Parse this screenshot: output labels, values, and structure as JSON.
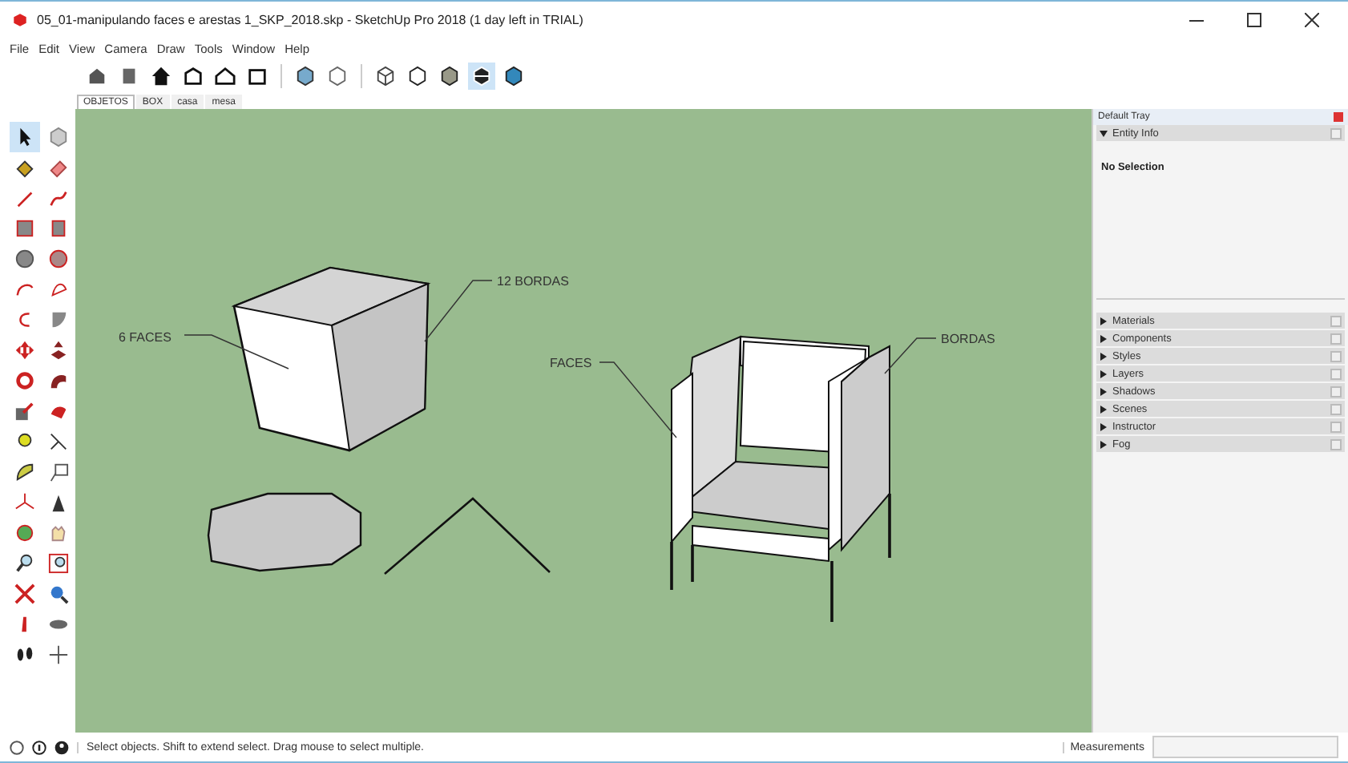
{
  "window": {
    "title": "05_01-manipulando faces e arestas 1_SKP_2018.skp - SketchUp Pro 2018 (1 day left in TRIAL)"
  },
  "menu": [
    "File",
    "Edit",
    "View",
    "Camera",
    "Draw",
    "Tools",
    "Window",
    "Help"
  ],
  "scene_tabs": [
    {
      "label": "OBJETOS",
      "selected": true
    },
    {
      "label": "BOX",
      "selected": false
    },
    {
      "label": "casa",
      "selected": false
    },
    {
      "label": "mesa",
      "selected": false
    }
  ],
  "canvas": {
    "labels": [
      "6 FACES",
      "12 BORDAS",
      "FACES",
      "BORDAS"
    ]
  },
  "tray": {
    "title": "Default Tray",
    "panels": [
      {
        "label": "Entity Info",
        "expanded": true,
        "content": "No Selection"
      },
      {
        "label": "Materials",
        "expanded": false
      },
      {
        "label": "Components",
        "expanded": false
      },
      {
        "label": "Styles",
        "expanded": false
      },
      {
        "label": "Layers",
        "expanded": false
      },
      {
        "label": "Shadows",
        "expanded": false
      },
      {
        "label": "Scenes",
        "expanded": false
      },
      {
        "label": "Instructor",
        "expanded": false
      },
      {
        "label": "Fog",
        "expanded": false
      }
    ]
  },
  "status_bar": {
    "message": "Select objects. Shift to extend select. Drag mouse to select multiple.",
    "measurements_label": "Measurements"
  }
}
